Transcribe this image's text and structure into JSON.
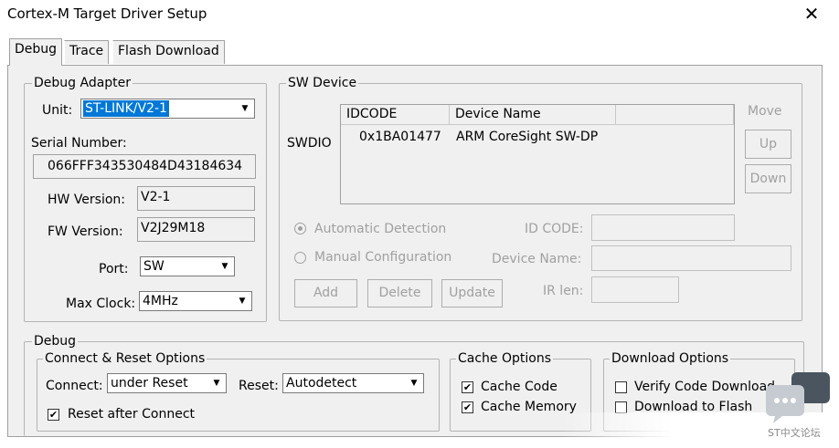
{
  "window": {
    "title": "Cortex-M Target Driver Setup",
    "close_glyph": "✕"
  },
  "tabs": [
    {
      "label": "Debug",
      "active": true
    },
    {
      "label": "Trace",
      "active": false
    },
    {
      "label": "Flash Download",
      "active": false
    }
  ],
  "debug_adapter": {
    "legend": "Debug Adapter",
    "unit_label": "Unit:",
    "unit_value": "ST-LINK/V2-1",
    "serial_label": "Serial Number:",
    "serial_value": "066FFF343530484D43184634",
    "hw_label": "HW Version:",
    "hw_value": "V2-1",
    "fw_label": "FW Version:",
    "fw_value": "V2J29M18",
    "port_label": "Port:",
    "port_value": "SW",
    "clock_label": "Max Clock:",
    "clock_value": "4MHz"
  },
  "sw_device": {
    "legend": "SW Device",
    "swdio_label": "SWDIO",
    "columns": [
      "IDCODE",
      "Device Name"
    ],
    "rows": [
      {
        "idcode": "0x1BA01477",
        "name": "ARM CoreSight SW-DP"
      }
    ],
    "move_label": "Move",
    "up_label": "Up",
    "down_label": "Down",
    "auto_detect_label": "Automatic Detection",
    "manual_config_label": "Manual Configuration",
    "id_code_label": "ID CODE:",
    "device_name_label": "Device Name:",
    "ir_len_label": "IR len:",
    "add_label": "Add",
    "delete_label": "Delete",
    "update_label": "Update"
  },
  "debug": {
    "legend": "Debug",
    "connect_reset": {
      "legend": "Connect & Reset Options",
      "connect_label": "Connect:",
      "connect_value": "under Reset",
      "reset_label": "Reset:",
      "reset_value": "Autodetect",
      "reset_after_connect_label": "Reset after Connect"
    },
    "cache": {
      "legend": "Cache Options",
      "cache_code_label": "Cache Code",
      "cache_memory_label": "Cache Memory"
    },
    "download": {
      "legend": "Download Options",
      "verify_label": "Verify Code Download",
      "download_flash_label": "Download to Flash"
    }
  },
  "watermark": {
    "text": "ST中文论坛"
  },
  "glyphs": {
    "dropdown_arrow": "▼",
    "check": "✔"
  }
}
